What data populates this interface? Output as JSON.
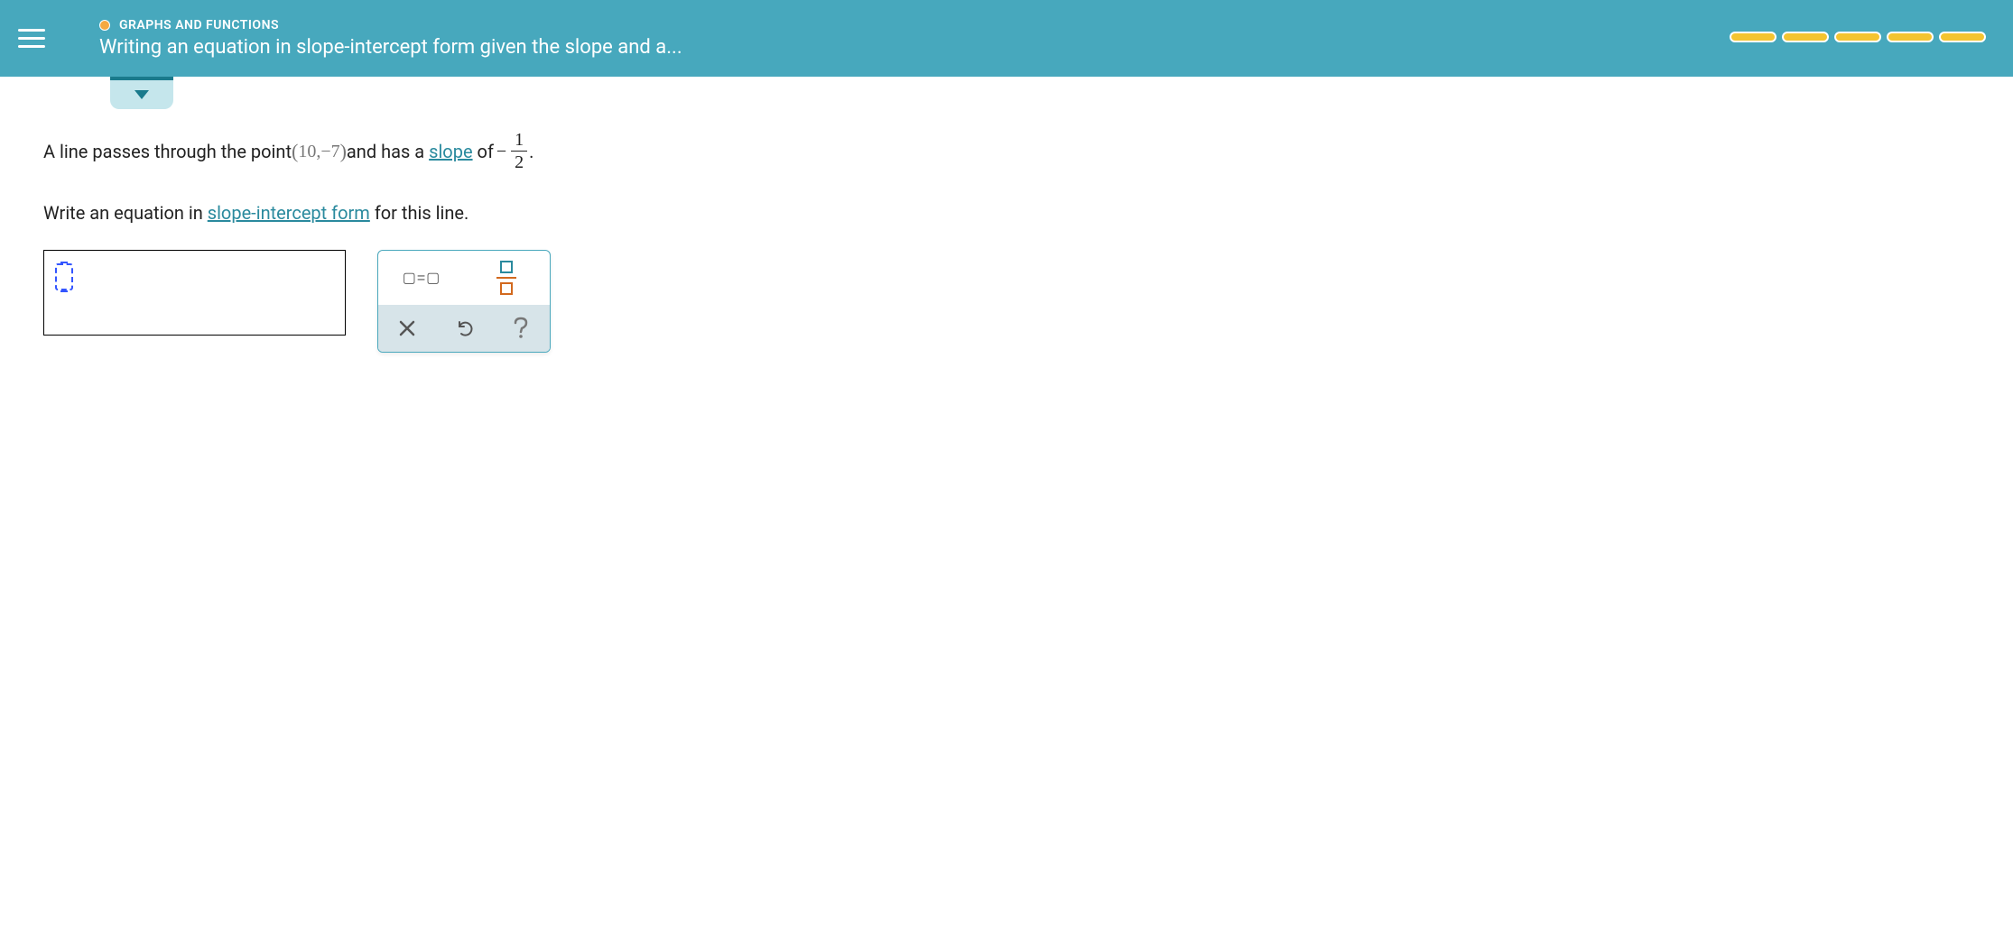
{
  "header": {
    "category": "GRAPHS AND FUNCTIONS",
    "title": "Writing an equation in slope-intercept form given the slope and a...",
    "progress_segments": 5
  },
  "problem": {
    "prefix": "A line passes through the point ",
    "point_x": "10",
    "point_comma": ", ",
    "point_y_sign": "−",
    "point_y": "7",
    "mid1": " and has a ",
    "link_slope": "slope",
    "mid2": " of ",
    "slope_sign": "−",
    "slope_num": "1",
    "slope_den": "2",
    "period": "."
  },
  "instruction": {
    "prefix": "Write an equation in ",
    "link": "slope-intercept form",
    "suffix": " for this line."
  },
  "palette": {
    "equation_label": "▢=▢",
    "clear_title": "Clear",
    "undo_title": "Undo",
    "help_title": "Help"
  }
}
